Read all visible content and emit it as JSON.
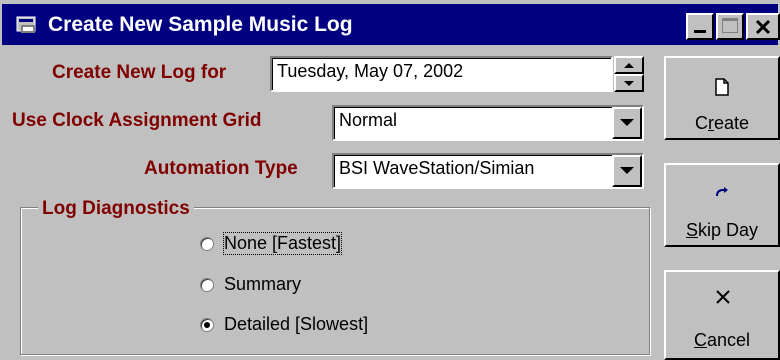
{
  "window": {
    "title": "Create New Sample Music Log"
  },
  "form": {
    "log_date_label": "Create New Log for",
    "log_date_value": "Tuesday, May 07, 2002",
    "clock_grid_label": "Use Clock Assignment Grid",
    "clock_grid_value": "Normal",
    "automation_label": "Automation Type",
    "automation_value": "BSI WaveStation/Simian"
  },
  "diagnostics": {
    "title": "Log Diagnostics",
    "options": [
      "None [Fastest]",
      "Summary",
      "Detailed [Slowest]"
    ],
    "selected": "Detailed [Slowest]"
  },
  "buttons": {
    "create": {
      "icon": "document-icon",
      "prefix": "C",
      "underline": "r",
      "suffix": "eate"
    },
    "skip": {
      "icon": "redo-arrow-icon",
      "prefix": "",
      "underline": "S",
      "suffix": "kip Day"
    },
    "cancel": {
      "icon": "x-icon",
      "prefix": "",
      "underline": "C",
      "suffix": "ancel"
    }
  },
  "icons": {
    "title": "window-app-icon",
    "minimize": "minimize-icon",
    "maximize": "maximize-icon",
    "close": "close-icon"
  },
  "colors": {
    "titlebar": "#000080",
    "label": "#800000",
    "face": "#c0c0c0"
  }
}
